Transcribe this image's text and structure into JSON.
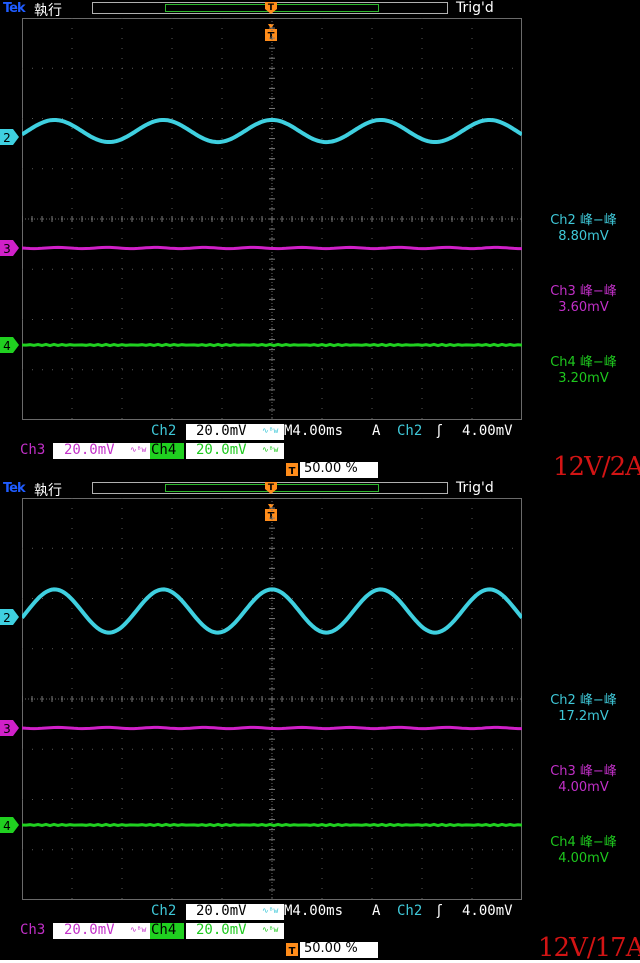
{
  "screens": [
    {
      "id": "top",
      "brand": "Tek",
      "run_status": "執行",
      "trigger_state": "Trig'd",
      "ch2_label": "Ch2",
      "ch2_scale": "20.0mV",
      "timebase": "M4.00ms",
      "trigger_mode": "A",
      "trigger_source": "Ch2",
      "trigger_level": "4.00mV",
      "ch3_label": "Ch3",
      "ch3_scale": "20.0mV",
      "ch4_label": "Ch4",
      "ch4_scale": "20.0mV",
      "trigger_position": "50.00 %",
      "measurements": [
        {
          "label": "Ch2 峰−峰",
          "value": "8.80mV",
          "color": "#3fc8d8"
        },
        {
          "label": "Ch3 峰−峰",
          "value": "3.60mV",
          "color": "#c230c8"
        },
        {
          "label": "Ch4 峰−峰",
          "value": "3.20mV",
          "color": "#1ec81e"
        }
      ],
      "caption": "12V/2A",
      "ch2_peak_to_peak_mV": 8.8,
      "ch2_cycles": 4.6
    },
    {
      "id": "bottom",
      "brand": "Tek",
      "run_status": "執行",
      "trigger_state": "Trig'd",
      "ch2_label": "Ch2",
      "ch2_scale": "20.0mV",
      "timebase": "M4.00ms",
      "trigger_mode": "A",
      "trigger_source": "Ch2",
      "trigger_level": "4.00mV",
      "ch3_label": "Ch3",
      "ch3_scale": "20.0mV",
      "ch4_label": "Ch4",
      "ch4_scale": "20.0mV",
      "trigger_position": "50.00 %",
      "measurements": [
        {
          "label": "Ch2 峰−峰",
          "value": "17.2mV",
          "color": "#3fc8d8"
        },
        {
          "label": "Ch3 峰−峰",
          "value": "4.00mV",
          "color": "#c230c8"
        },
        {
          "label": "Ch4 峰−峰",
          "value": "4.00mV",
          "color": "#1ec81e"
        }
      ],
      "caption": "12V/17A",
      "ch2_peak_to_peak_mV": 17.2,
      "ch2_cycles": 4.6
    }
  ],
  "colors": {
    "ch2": "#3fd0e0",
    "ch3": "#d020c8",
    "ch4": "#20d020",
    "trigger": "#ff8c1a",
    "caption": "#d21414"
  },
  "channel_marker_numbers": [
    "2",
    "3",
    "4"
  ]
}
